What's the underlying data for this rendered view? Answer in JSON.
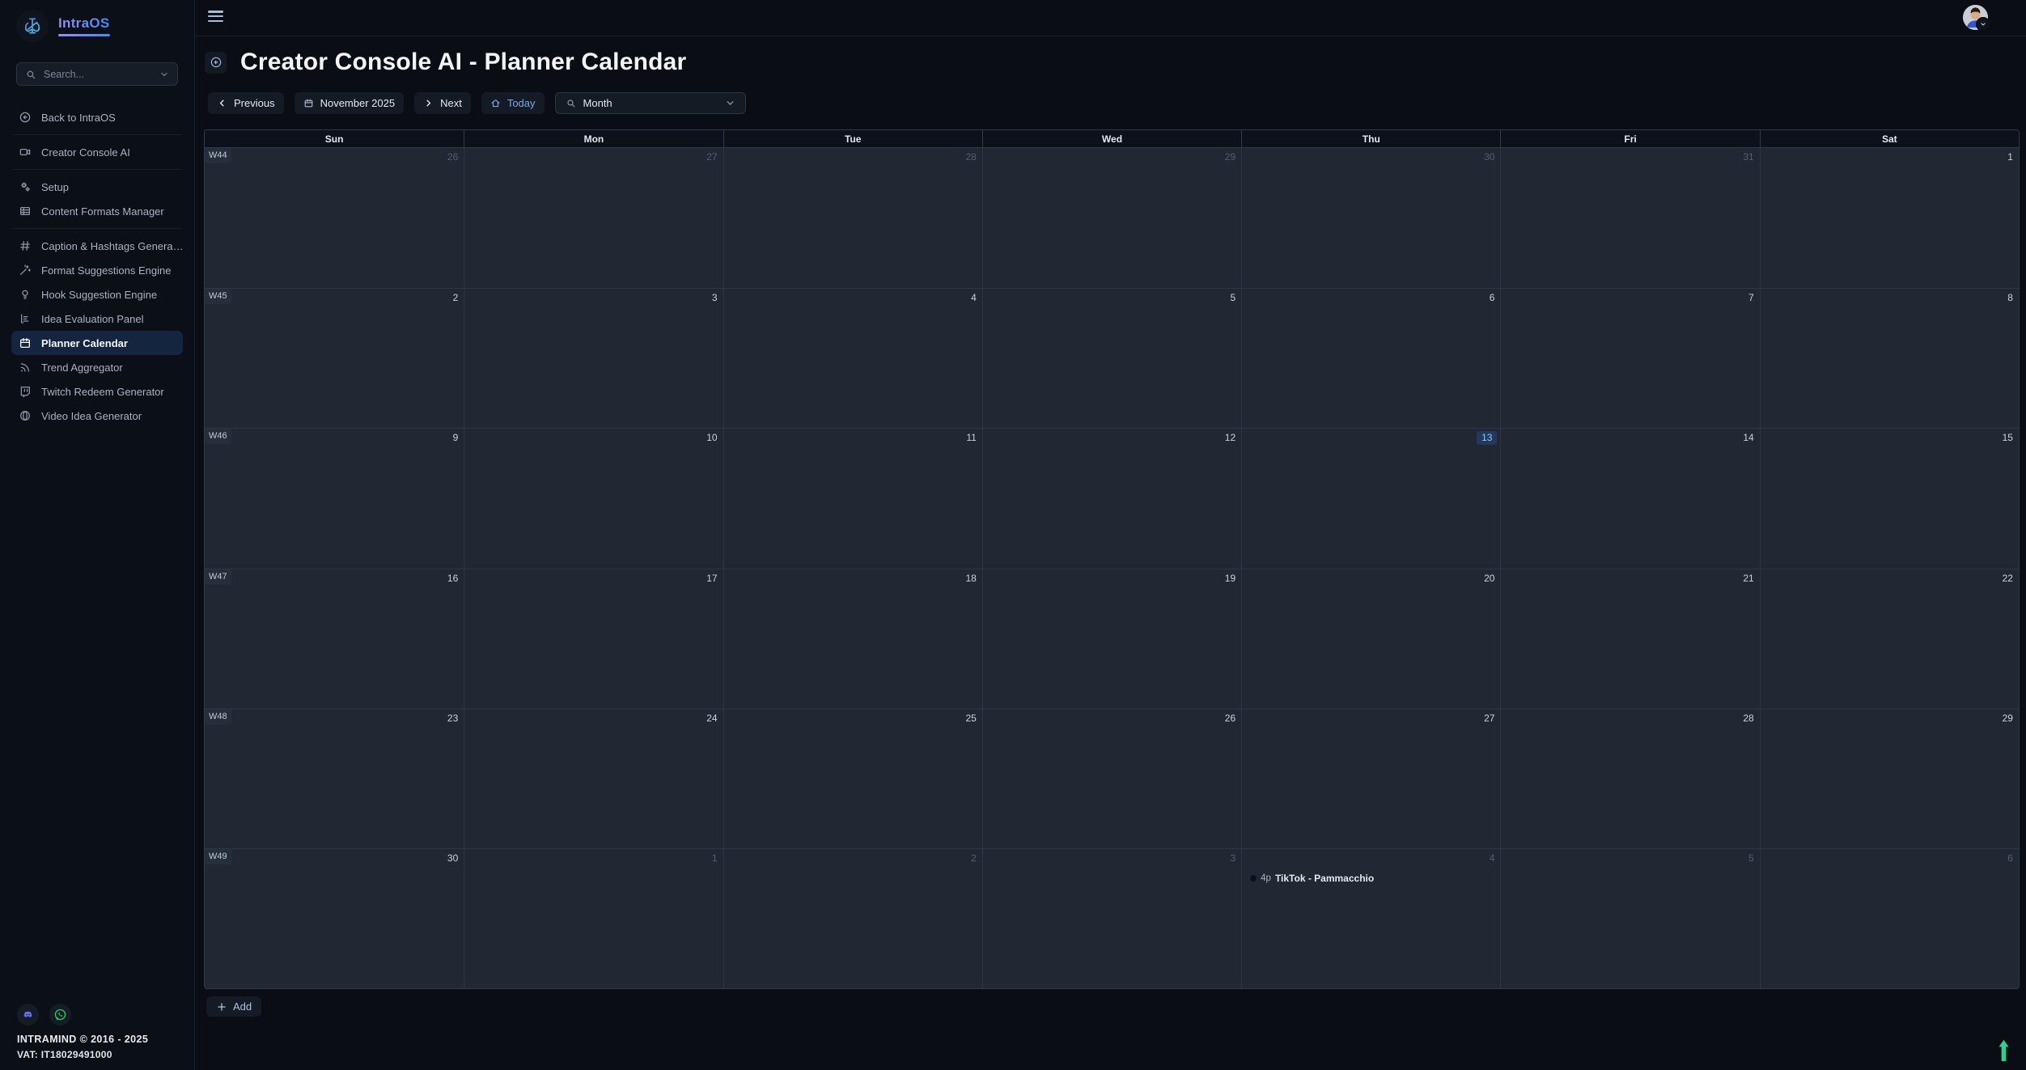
{
  "app": {
    "name": "IntraOS",
    "logo_icon": "gamepad-logo-icon"
  },
  "theme": {
    "brand_gradient_from": "#9a8cf5",
    "brand_gradient_to": "#3e8ef7",
    "accent_blue": "#78a6e8",
    "today_badge_bg": "#21395c",
    "today_badge_text": "#9cc3f2",
    "event_dot_color": "#0d1219",
    "discord_color": "#5865F2",
    "whatsapp_color": "#25D366",
    "scroll_arrow_color": "#2fd08c"
  },
  "topbar": {
    "menu_icon": "hamburger-icon",
    "avatar_icon": "user-avatar",
    "avatar_chevron_icon": "chevron-down-icon"
  },
  "sidebar": {
    "search_placeholder": "Search...",
    "search_icon": "search-icon",
    "search_chevron_icon": "chevron-down-icon",
    "items": [
      {
        "label": "Back to IntraOS",
        "icon": "arrow-left-circle-icon"
      },
      {
        "divider": true
      },
      {
        "label": "Creator Console AI",
        "icon": "video-camera-icon"
      },
      {
        "divider": true
      },
      {
        "label": "Setup",
        "icon": "gears-icon"
      },
      {
        "label": "Content Formats Manager",
        "icon": "table-icon"
      },
      {
        "divider": true
      },
      {
        "label": "Caption & Hashtags Genera…",
        "icon": "hash-icon"
      },
      {
        "label": "Format Suggestions Engine",
        "icon": "magic-wand-icon"
      },
      {
        "label": "Hook Suggestion Engine",
        "icon": "lightbulb-icon"
      },
      {
        "label": "Idea Evaluation Panel",
        "icon": "bar-chart-icon"
      },
      {
        "label": "Planner Calendar",
        "icon": "calendar-icon",
        "active": true
      },
      {
        "label": "Trend Aggregator",
        "icon": "rss-icon"
      },
      {
        "label": "Twitch Redeem Generator",
        "icon": "twitch-icon"
      },
      {
        "label": "Video Idea Generator",
        "icon": "brain-icon"
      }
    ],
    "footer": {
      "social_icons": [
        "discord-icon",
        "whatsapp-icon"
      ],
      "company_line": "INTRAMIND © 2016 - 2025",
      "vat_line": "VAT: IT18029491000"
    }
  },
  "header": {
    "back_icon": "arrow-left-circle-icon",
    "title": "Creator Console AI - Planner Calendar"
  },
  "toolbar": {
    "previous_label": "Previous",
    "month_label": "November 2025",
    "next_label": "Next",
    "today_label": "Today",
    "view_selected": "Month"
  },
  "calendar": {
    "day_headers": [
      "Sun",
      "Mon",
      "Tue",
      "Wed",
      "Thu",
      "Fri",
      "Sat"
    ],
    "weeks": [
      {
        "label": "W44",
        "days": [
          {
            "date": 26,
            "other": true
          },
          {
            "date": 27,
            "other": true
          },
          {
            "date": 28,
            "other": true
          },
          {
            "date": 29,
            "other": true
          },
          {
            "date": 30,
            "other": true
          },
          {
            "date": 31,
            "other": true
          },
          {
            "date": 1
          }
        ]
      },
      {
        "label": "W45",
        "days": [
          {
            "date": 2
          },
          {
            "date": 3
          },
          {
            "date": 4
          },
          {
            "date": 5
          },
          {
            "date": 6
          },
          {
            "date": 7
          },
          {
            "date": 8
          }
        ]
      },
      {
        "label": "W46",
        "days": [
          {
            "date": 9
          },
          {
            "date": 10
          },
          {
            "date": 11
          },
          {
            "date": 12
          },
          {
            "date": 13,
            "today": true
          },
          {
            "date": 14
          },
          {
            "date": 15
          }
        ]
      },
      {
        "label": "W47",
        "days": [
          {
            "date": 16
          },
          {
            "date": 17
          },
          {
            "date": 18
          },
          {
            "date": 19
          },
          {
            "date": 20
          },
          {
            "date": 21
          },
          {
            "date": 22
          }
        ]
      },
      {
        "label": "W48",
        "days": [
          {
            "date": 23
          },
          {
            "date": 24
          },
          {
            "date": 25
          },
          {
            "date": 26
          },
          {
            "date": 27
          },
          {
            "date": 28
          },
          {
            "date": 29
          }
        ]
      },
      {
        "label": "W49",
        "days": [
          {
            "date": 30
          },
          {
            "date": 1,
            "other": true
          },
          {
            "date": 2,
            "other": true
          },
          {
            "date": 3,
            "other": true
          },
          {
            "date": 4,
            "other": true,
            "events": [
              {
                "time": "4p",
                "title": "TikTok - Pammacchio"
              }
            ]
          },
          {
            "date": 5,
            "other": true
          },
          {
            "date": 6,
            "other": true
          }
        ]
      }
    ]
  },
  "main": {
    "add_label": "Add",
    "add_icon": "plus-icon",
    "scroll_icon": "arrow-up-icon"
  }
}
